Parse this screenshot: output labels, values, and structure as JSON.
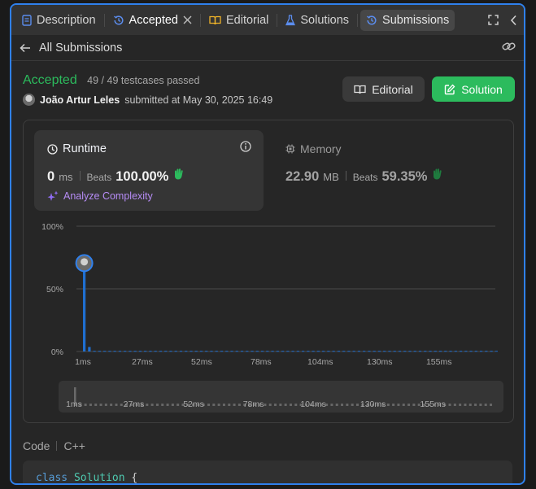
{
  "tabs": [
    {
      "label": "Description",
      "icon": "description-icon",
      "state": "normal"
    },
    {
      "label": "Accepted",
      "icon": "history-icon",
      "state": "active",
      "closable": true
    },
    {
      "label": "Editorial",
      "icon": "book-icon",
      "state": "normal"
    },
    {
      "label": "Solutions",
      "icon": "flask-icon",
      "state": "normal"
    },
    {
      "label": "Submissions",
      "icon": "history-icon",
      "state": "selected"
    }
  ],
  "subheader": {
    "back_label": "All Submissions"
  },
  "submission": {
    "status": "Accepted",
    "testcases": "49 / 49 testcases passed",
    "author": "João Artur Leles",
    "submitted_text": "submitted at May 30, 2025 16:49"
  },
  "buttons": {
    "editorial": "Editorial",
    "solution": "Solution"
  },
  "runtime": {
    "title": "Runtime",
    "value": "0",
    "unit": "ms",
    "beats_label": "Beats",
    "beats": "100.00%",
    "analyze": "Analyze Complexity"
  },
  "memory": {
    "title": "Memory",
    "value": "22.90",
    "unit": "MB",
    "beats_label": "Beats",
    "beats": "59.35%"
  },
  "code": {
    "label": "Code",
    "language": "C++",
    "first_line_keyword": "class",
    "first_line_name": "Solution",
    "first_line_brace": "{"
  },
  "colors": {
    "accent": "#2cbb5d",
    "bar": "#1f6fd1",
    "highlight": "#2f80ed",
    "purple": "#b68cf5"
  },
  "chart_data": {
    "type": "bar",
    "y_ticks": [
      "0%",
      "50%",
      "100%"
    ],
    "ylim": [
      0,
      100
    ],
    "x_ticks": [
      "1ms",
      "27ms",
      "52ms",
      "78ms",
      "104ms",
      "130ms",
      "155ms"
    ],
    "brush_ticks": [
      "1ms",
      "27ms",
      "52ms",
      "78ms",
      "104ms",
      "130ms",
      "155ms"
    ],
    "series": [
      {
        "values": [
          66,
          3.6,
          0.5,
          0.5,
          0.5,
          0.5,
          0.5,
          0.5,
          0.5,
          0.5,
          0.5,
          0.5,
          0.5,
          0.5,
          0.5,
          0.5,
          0.5,
          0.5,
          0.5,
          0.5,
          0.5,
          0.5,
          0.5,
          0.5,
          0.5,
          0.5,
          0.5,
          0.5,
          0.5,
          0.5,
          0.5,
          0.5,
          0.5,
          0.5,
          0.5,
          0.5,
          0.5,
          0.5,
          0.5,
          0.5,
          0.5,
          0.5,
          0.5,
          0.5,
          0.5,
          0.5,
          0.5,
          0.5,
          0.5,
          0.5,
          0.5,
          0.5,
          0.5,
          0.5,
          0.5,
          0.5,
          0.5,
          0.5,
          0.5,
          0.5,
          0.5,
          0.5,
          0.5,
          0.5,
          0.5,
          0.5,
          0.5,
          0.5,
          0.5,
          0.5,
          0.5,
          0.5,
          0.5,
          0.5,
          0.5,
          0.5,
          0.5,
          0.5,
          0.5,
          0.5,
          0.5,
          0.5
        ]
      }
    ],
    "highlighted_index": 0,
    "grid": true
  }
}
